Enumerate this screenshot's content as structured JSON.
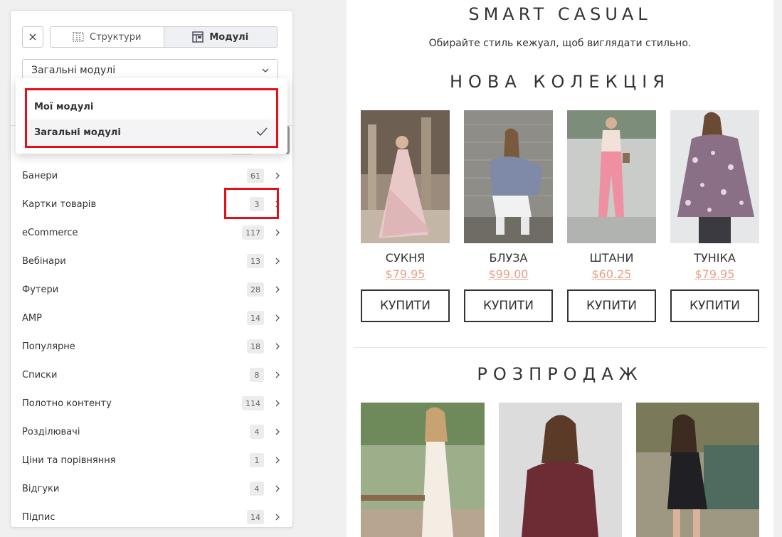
{
  "panel": {
    "tabs": [
      {
        "label": "Структури",
        "icon": "structure-grid-icon"
      },
      {
        "label": "Модулі",
        "icon": "modules-icon",
        "active": true
      }
    ],
    "select": {
      "value": "Загальні модулі"
    },
    "dropdown": {
      "options": [
        {
          "label": "Мої модулі",
          "selected": false
        },
        {
          "label": "Загальні модулі",
          "selected": true
        }
      ]
    },
    "categories": [
      {
        "label": "Банери",
        "count": "61"
      },
      {
        "label": "Картки товарів",
        "count": "3"
      },
      {
        "label": "eCommerce",
        "count": "117"
      },
      {
        "label": "Вебінари",
        "count": "13"
      },
      {
        "label": "Футери",
        "count": "28"
      },
      {
        "label": "AMP",
        "count": "14"
      },
      {
        "label": "Популярне",
        "count": "18"
      },
      {
        "label": "Списки",
        "count": "8"
      },
      {
        "label": "Полотно контенту",
        "count": "114"
      },
      {
        "label": "Розділювачі",
        "count": "4"
      },
      {
        "label": "Ціни та порівняння",
        "count": "1"
      },
      {
        "label": "Відгуки",
        "count": "4"
      },
      {
        "label": "Підпис",
        "count": "14"
      }
    ]
  },
  "preview": {
    "title": "SMART CASUAL",
    "subtitle": "Обирайте стиль кежуал, щоб виглядати стильно.",
    "new_collection": "НОВА  КОЛЕКЦІЯ",
    "products": [
      {
        "name": "СУКНЯ",
        "price": "$79.95",
        "button": "КУПИТИ"
      },
      {
        "name": "БЛУЗА",
        "price": "$99.00",
        "button": "КУПИТИ"
      },
      {
        "name": "ШТАНИ",
        "price": "$60.25",
        "button": "КУПИТИ"
      },
      {
        "name": "ТУНІКА",
        "price": "$79.95",
        "button": "КУПИТИ"
      }
    ],
    "sale_title": "РОЗПРОДАЖ"
  },
  "colors": {
    "highlight": "#e3101a",
    "price": "#e8a084",
    "text": "#333333"
  }
}
